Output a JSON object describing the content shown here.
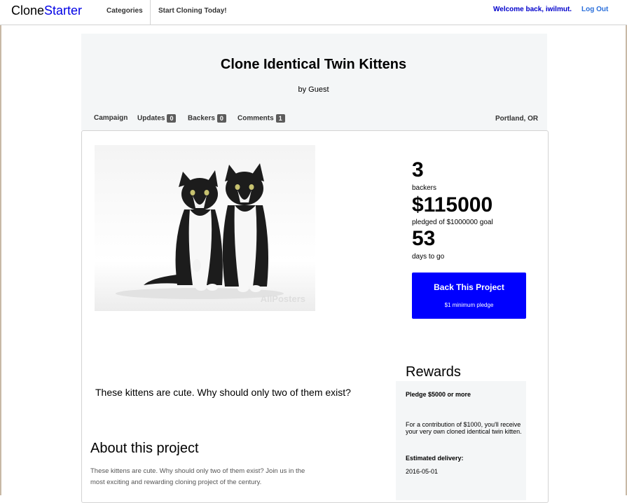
{
  "nav": {
    "logo_part1": "Clone",
    "logo_part2": "Starter",
    "categories": "Categories",
    "start": "Start Cloning Today!",
    "welcome": "Welcome back, iwilmut.",
    "logout": "Log Out"
  },
  "project": {
    "title": "Clone Identical Twin Kittens",
    "by": "by Guest",
    "location": "Portland, OR",
    "image_watermark": "AllPosters",
    "blurb": "These kittens are cute. Why should only two of them exist?"
  },
  "tabs": {
    "campaign": "Campaign",
    "updates": "Updates",
    "updates_count": "0",
    "backers": "Backers",
    "backers_count": "0",
    "comments": "Comments",
    "comments_count": "1"
  },
  "stats": {
    "backers": "3",
    "backers_label": "backers",
    "pledged": "$115000",
    "pledged_label": "pledged of $1000000 goal",
    "days": "53",
    "days_label": "days to go"
  },
  "back_button": {
    "title": "Back This Project",
    "subtitle": "$1 minimum pledge"
  },
  "about": {
    "heading": "About this project",
    "text": "These kittens are cute. Why should only two of them exist? Join us in the most exciting and rewarding cloning project of the century."
  },
  "rewards": {
    "heading": "Rewards",
    "pledge": "Pledge $5000 or more",
    "description": "For a contribution of $1000, you'll receive your very own cloned identical twin kitten.",
    "delivery_label": "Estimated delivery:",
    "delivery_date": "2016-05-01"
  },
  "colors": {
    "accent": "#0000ff",
    "header_bg": "#f4f6f7",
    "badge": "#5b5b5b"
  }
}
